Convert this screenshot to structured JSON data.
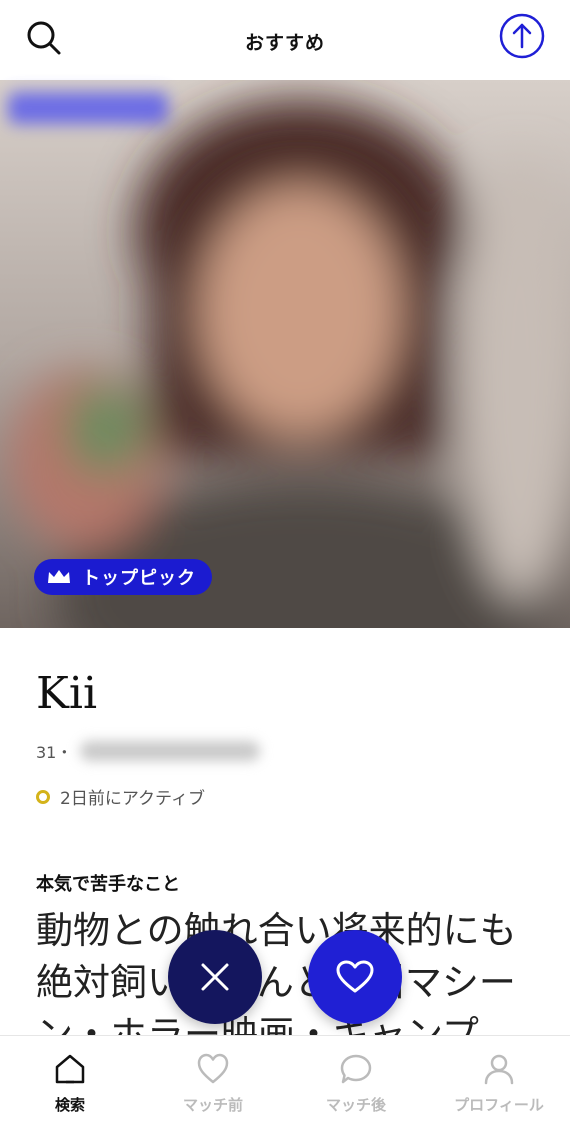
{
  "header": {
    "title": "おすすめ",
    "search_icon": "search-icon",
    "action_icon": "arrow-up-circle-icon",
    "accent": "#1f1fd6"
  },
  "profile": {
    "top_pick_label": "トップピック",
    "top_pick_icon": "crown-icon",
    "name": "Kii",
    "age": "31・",
    "active_status": "2日前にアクティブ",
    "active_color": "#d4b31a",
    "section_title": "本気で苦手なこと",
    "section_text": "動物との触れ合い将来的にも絶対飼いませんと絶叫マシーン・ホラー映画・キャンプ"
  },
  "actions": {
    "dislike_icon": "close-icon",
    "like_icon": "heart-icon"
  },
  "tabs": [
    {
      "label": "検索",
      "icon": "home-icon",
      "active": true
    },
    {
      "label": "マッチ前",
      "icon": "heart-outline-icon",
      "active": false
    },
    {
      "label": "マッチ後",
      "icon": "chat-bubble-icon",
      "active": false
    },
    {
      "label": "プロフィール",
      "icon": "user-icon",
      "active": false
    }
  ]
}
